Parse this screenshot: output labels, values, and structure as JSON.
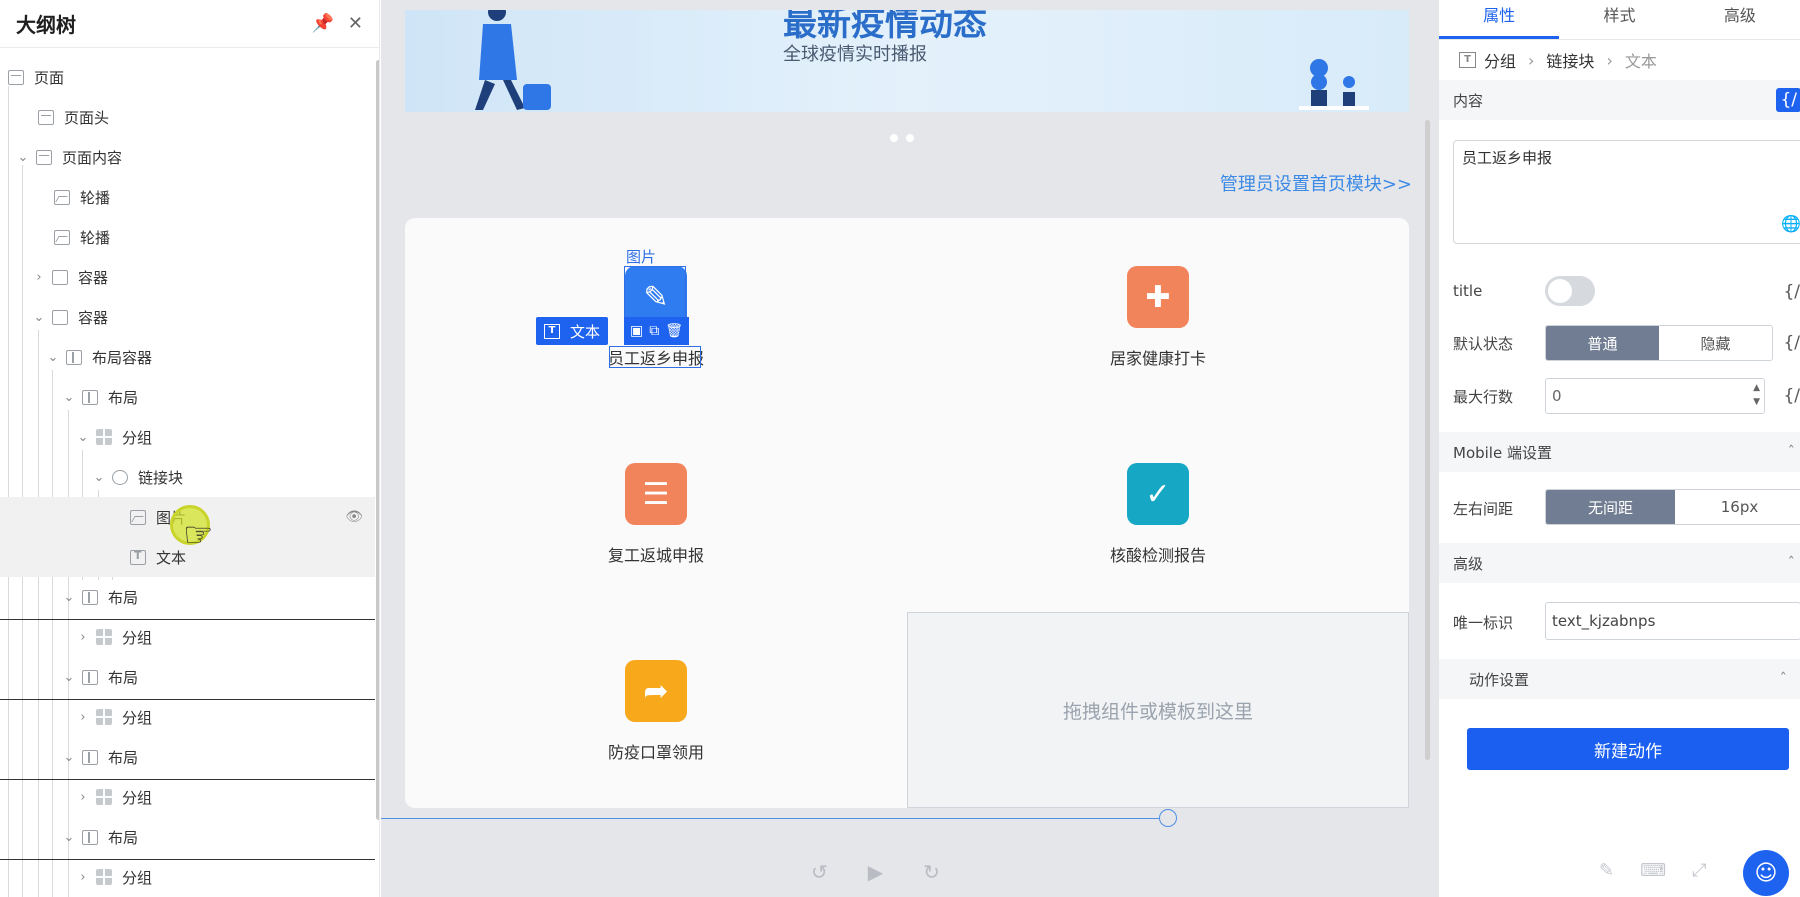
{
  "outline": {
    "title": "大纲树",
    "items": [
      {
        "label": "页面",
        "icon": "page-icon"
      },
      {
        "label": "页面头",
        "icon": "page-header-icon"
      },
      {
        "label": "页面内容",
        "icon": "page-content-icon"
      },
      {
        "label": "轮播",
        "icon": "carousel-icon"
      },
      {
        "label": "轮播",
        "icon": "carousel-icon"
      },
      {
        "label": "容器",
        "icon": "container-icon"
      },
      {
        "label": "容器",
        "icon": "container-icon"
      },
      {
        "label": "布局容器",
        "icon": "layout-container-icon"
      },
      {
        "label": "布局",
        "icon": "layout-icon"
      },
      {
        "label": "分组",
        "icon": "group-icon"
      },
      {
        "label": "链接块",
        "icon": "link-block-icon"
      },
      {
        "label": "图片",
        "icon": "image-icon"
      },
      {
        "label": "文本",
        "icon": "text-icon"
      },
      {
        "label": "布局",
        "icon": "layout-icon"
      },
      {
        "label": "分组",
        "icon": "group-icon"
      },
      {
        "label": "布局",
        "icon": "layout-icon"
      },
      {
        "label": "分组",
        "icon": "group-icon"
      },
      {
        "label": "布局",
        "icon": "layout-icon"
      },
      {
        "label": "分组",
        "icon": "group-icon"
      },
      {
        "label": "布局",
        "icon": "layout-icon"
      },
      {
        "label": "分组",
        "icon": "group-icon"
      }
    ]
  },
  "canvas": {
    "banner_title": "最新疫情动态",
    "banner_subtitle": "全球疫情实时播报",
    "admin_link": "管理员设置首页模块>>",
    "cards": [
      {
        "label": "员工返乡申报",
        "color": "#2f7bf0"
      },
      {
        "label": "居家健康打卡",
        "color": "#f2845c"
      },
      {
        "label": "复工返城申报",
        "color": "#f2845c"
      },
      {
        "label": "核酸检测报告",
        "color": "#16a7c4"
      },
      {
        "label": "防疫口罩领用",
        "color": "#f7a81b"
      }
    ],
    "drop_zone": "拖拽组件或模板到这里",
    "selection": {
      "image_label": "图片",
      "text_tag": "文本"
    }
  },
  "props": {
    "tabs": [
      "属性",
      "样式",
      "高级"
    ],
    "breadcrumb": [
      "分组",
      "链接块",
      "文本"
    ],
    "content_section": "内容",
    "content_value": "员工返乡申报",
    "title_label": "title",
    "default_state_label": "默认状态",
    "default_state_options": [
      "普通",
      "隐藏"
    ],
    "max_rows_label": "最大行数",
    "max_rows_value": "0",
    "mobile_section": "Mobile 端设置",
    "lr_spacing_label": "左右间距",
    "lr_spacing_options": [
      "无间距",
      "16px"
    ],
    "advanced_section": "高级",
    "uid_label": "唯一标识",
    "uid_value": "text_kjzabnps",
    "action_section": "动作设置",
    "new_action_button": "新建动作",
    "fx_symbol": "{/",
    "accent_color": "#1e63f0"
  }
}
